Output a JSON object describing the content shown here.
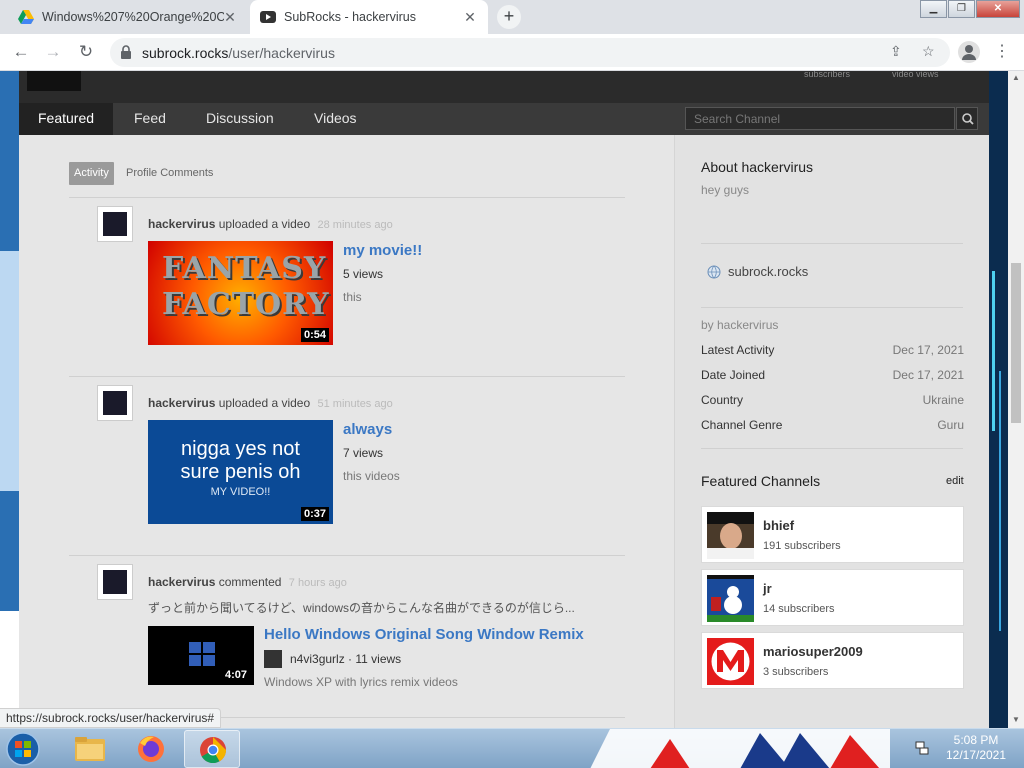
{
  "browser": {
    "tabs": [
      {
        "title": "Windows%207%20Orange%20C..."
      },
      {
        "title": "SubRocks - hackervirus"
      }
    ],
    "url_host": "subrock.rocks",
    "url_path": "/user/hackervirus",
    "status_url": "https://subrock.rocks/user/hackervirus#"
  },
  "channel": {
    "header_stats": [
      "subscribers",
      "video views"
    ],
    "nav_tabs": [
      "Featured",
      "Feed",
      "Discussion",
      "Videos"
    ],
    "search_placeholder": "Search Channel",
    "subtabs": [
      "Activity",
      "Profile Comments"
    ]
  },
  "activity": [
    {
      "user": "hackervirus",
      "action": "uploaded a video",
      "time": "28 minutes ago",
      "video_title": "my movie!!",
      "meta": "5 views",
      "desc": "this",
      "duration": "0:54",
      "thumb_text": "FANTASY FACTORY"
    },
    {
      "user": "hackervirus",
      "action": "uploaded a video",
      "time": "51 minutes ago",
      "video_title": "always",
      "meta": "7 views",
      "desc": "this videos",
      "duration": "0:37",
      "thumb_line1": "nigga yes not",
      "thumb_line2": "sure penis oh",
      "thumb_line3": "MY VIDEO!!"
    },
    {
      "user": "hackervirus",
      "action": "commented",
      "time": "7 hours ago",
      "comment": "ずっと前から聞いてるけど、windowsの音からこんな名曲ができるのが信じら...",
      "video_title": "Hello Windows Original Song Window Remix",
      "author": "n4vi3gurlz",
      "views": "· 11 views",
      "desc": "Windows XP with lyrics remix videos",
      "duration": "4:07"
    }
  ],
  "sidebar": {
    "about_title": "About hackervirus",
    "about_text": "hey guys",
    "website": "subrock.rocks",
    "by_line": "by hackervirus",
    "rows": [
      {
        "label": "Latest Activity",
        "value": "Dec 17, 2021"
      },
      {
        "label": "Date Joined",
        "value": "Dec 17, 2021"
      },
      {
        "label": "Country",
        "value": "Ukraine"
      },
      {
        "label": "Channel Genre",
        "value": "Guru"
      }
    ],
    "featured_title": "Featured Channels",
    "edit_label": "edit",
    "featured": [
      {
        "name": "bhief",
        "subs": "191 subscribers"
      },
      {
        "name": "jr",
        "subs": "14 subscribers"
      },
      {
        "name": "mariosuper2009",
        "subs": "3 subscribers"
      }
    ]
  },
  "taskbar": {
    "time": "5:08 PM",
    "date": "12/17/2021"
  },
  "colors": {
    "link": "#3b78c4",
    "nav_dark": "#3a3a3a",
    "chrome_tabstrip": "#dee1e6"
  }
}
